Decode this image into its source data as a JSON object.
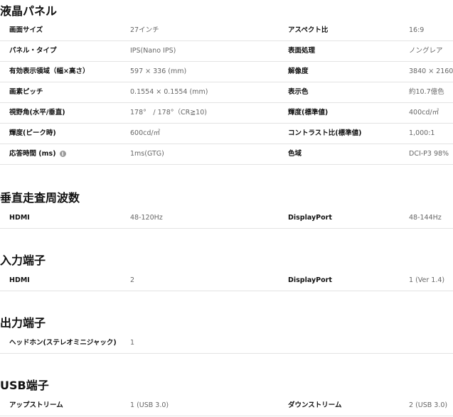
{
  "sections": {
    "panel": {
      "title": "液晶パネル",
      "rows": [
        {
          "l1": "画面サイズ",
          "v1": "27インチ",
          "l2": "アスペクト比",
          "v2": "16:9"
        },
        {
          "l1": "パネル・タイプ",
          "v1": "IPS(Nano IPS)",
          "l2": "表面処理",
          "v2": "ノングレア"
        },
        {
          "l1": "有効表示領域（幅×高さ）",
          "v1": "597 × 336 (mm)",
          "l2": "解像度",
          "v2": "3840 × 2160"
        },
        {
          "l1": "画素ピッチ",
          "v1": "0.1554 × 0.1554 (mm)",
          "l2": "表示色",
          "v2": "約10.7億色"
        },
        {
          "l1": "視野角(水平/垂直)",
          "v1": "178°　/ 178°（CR≧10)",
          "l2": "輝度(標準値)",
          "v2": "400cd/㎡"
        },
        {
          "l1": "輝度(ピーク時)",
          "v1": "600cd/㎡",
          "l2": "コントラスト比(標準値)",
          "v2": "1,000:1"
        },
        {
          "l1": "応答時間 (ms)",
          "v1": "1ms(GTG)",
          "l2": "色域",
          "v2": "DCI-P3 98%"
        }
      ]
    },
    "vfreq": {
      "title": "垂直走査周波数",
      "rows": [
        {
          "l1": "HDMI",
          "v1": "48-120Hz",
          "l2": "DisplayPort",
          "v2": "48-144Hz"
        }
      ]
    },
    "input": {
      "title": "入力端子",
      "rows": [
        {
          "l1": "HDMI",
          "v1": "2",
          "l2": "DisplayPort",
          "v2": "1 (Ver 1.4)"
        }
      ]
    },
    "output": {
      "title": "出力端子",
      "rows": [
        {
          "l1": "ヘッドホン(ステレオミニジャック)",
          "v1": "1"
        }
      ]
    },
    "usb": {
      "title": "USB端子",
      "rows": [
        {
          "l1": "アップストリーム",
          "v1": "1 (USB 3.0)",
          "l2": "ダウンストリーム",
          "v2": "2 (USB 3.0)"
        }
      ]
    }
  },
  "icons": {
    "info": "info-icon"
  },
  "info_icon_glyph": "i"
}
